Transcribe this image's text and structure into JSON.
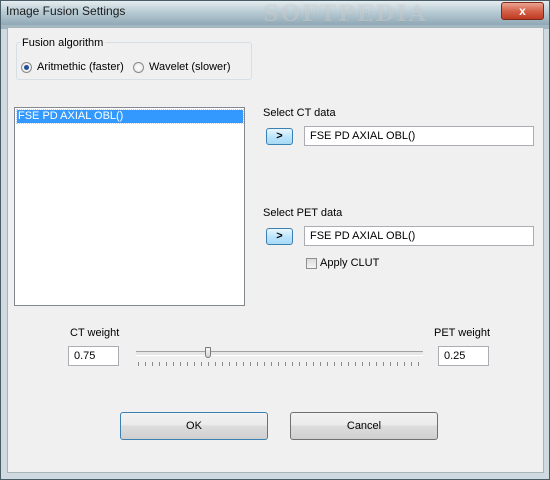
{
  "window": {
    "title": "Image Fusion Settings",
    "watermark": "SOFTPEDIA",
    "close_symbol": "x"
  },
  "fusion": {
    "group_label": "Fusion algorithm",
    "options": [
      {
        "label": "Aritmethic (faster)",
        "selected": true
      },
      {
        "label": "Wavelet (slower)",
        "selected": false
      }
    ]
  },
  "series_list": {
    "items": [
      "FSE PD AXIAL OBL()"
    ],
    "selected_index": 0
  },
  "ct": {
    "label": "Select CT data",
    "button_label": ">",
    "value": "FSE PD AXIAL OBL()"
  },
  "pet": {
    "label": "Select PET data",
    "button_label": ">",
    "value": "FSE PD AXIAL OBL()",
    "clut_label": "Apply CLUT",
    "clut_checked": false
  },
  "weights": {
    "ct_label": "CT weight",
    "ct_value": "0.75",
    "pet_label": "PET weight",
    "pet_value": "0.25",
    "slider_fraction": 0.25
  },
  "buttons": {
    "ok": "OK",
    "cancel": "Cancel"
  },
  "colors": {
    "selection": "#3399ff",
    "close_button": "#c7432a",
    "accent_border": "#3c7fb1"
  }
}
